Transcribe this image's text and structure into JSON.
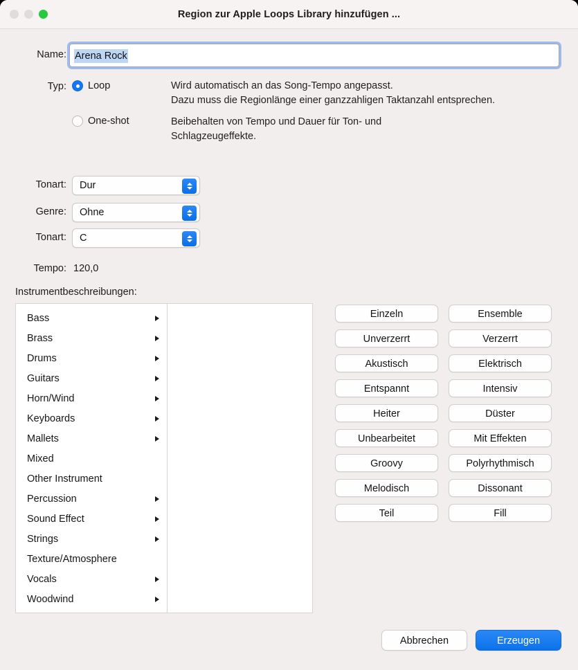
{
  "window": {
    "title": "Region zur Apple Loops Library hinzufügen ...",
    "traffic_lights": {
      "close": "close-button",
      "minimize": "minimize-button",
      "maximize": "maximize-button"
    },
    "colors": {
      "accent_blue": "#1876f2",
      "maximize_green": "#28c83f",
      "background": "#f2eeed",
      "titlebar": "#f7f3f2",
      "selection_highlight": "#bed6f5"
    }
  },
  "name_row": {
    "label": "Name:",
    "value": "Arena Rock",
    "placeholder": ""
  },
  "type_row": {
    "label": "Typ:",
    "options": [
      {
        "label": "Loop",
        "selected": true,
        "description": "Wird automatisch an das Song-Tempo angepasst.\nDazu muss die Regionlänge einer ganzzahligen Taktanzahl entsprechen."
      },
      {
        "label": "One-shot",
        "selected": false,
        "description": "Beibehalten von Tempo und Dauer für Ton- und\nSchlagzeugeffekte."
      }
    ]
  },
  "popups": [
    {
      "label": "Tonart:",
      "value": "Dur"
    },
    {
      "label": "Genre:",
      "value": "Ohne"
    },
    {
      "label": "Tonart:",
      "value": "C"
    }
  ],
  "tempo": {
    "label": "Tempo:",
    "value": "120,0"
  },
  "instruments": {
    "section_label": "Instrumentbeschreibungen:",
    "items": [
      {
        "label": "Bass",
        "has_submenu": true
      },
      {
        "label": "Brass",
        "has_submenu": true
      },
      {
        "label": "Drums",
        "has_submenu": true
      },
      {
        "label": "Guitars",
        "has_submenu": true
      },
      {
        "label": "Horn/Wind",
        "has_submenu": true
      },
      {
        "label": "Keyboards",
        "has_submenu": true
      },
      {
        "label": "Mallets",
        "has_submenu": true
      },
      {
        "label": "Mixed",
        "has_submenu": false
      },
      {
        "label": "Other Instrument",
        "has_submenu": false
      },
      {
        "label": "Percussion",
        "has_submenu": true
      },
      {
        "label": "Sound Effect",
        "has_submenu": true
      },
      {
        "label": "Strings",
        "has_submenu": true
      },
      {
        "label": "Texture/Atmosphere",
        "has_submenu": false
      },
      {
        "label": "Vocals",
        "has_submenu": true
      },
      {
        "label": "Woodwind",
        "has_submenu": true
      }
    ]
  },
  "descriptors": [
    "Einzeln",
    "Ensemble",
    "Unverzerrt",
    "Verzerrt",
    "Akustisch",
    "Elektrisch",
    "Entspannt",
    "Intensiv",
    "Heiter",
    "Düster",
    "Unbearbeitet",
    "Mit Effekten",
    "Groovy",
    "Polyrhythmisch",
    "Melodisch",
    "Dissonant",
    "Teil",
    "Fill"
  ],
  "footer": {
    "cancel_label": "Abbrechen",
    "create_label": "Erzeugen"
  }
}
